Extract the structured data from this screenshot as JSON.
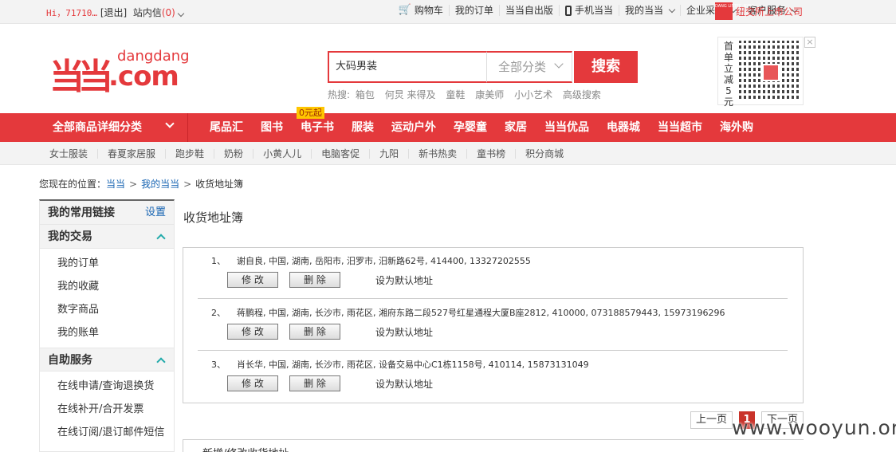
{
  "topbar": {
    "greeting": "Hi，71710…",
    "logout": "[退出]",
    "messages": "站内信",
    "message_count": "(0)",
    "links": [
      "购物车",
      "我的订单",
      "当当自出版",
      "手机当当",
      "我的当当",
      "企业采购",
      "客户服务"
    ],
    "nyse_badge": "DANG LISTED NYSE",
    "nyse_text": "纽交所上市公司"
  },
  "logo": {
    "cn": "当当",
    "en": "dangdang",
    "com": ".com"
  },
  "search": {
    "value": "大码男装",
    "category": "全部分类",
    "button": "搜索",
    "hot_label": "热搜:",
    "hot_words": [
      "箱包",
      "何炅 来得及",
      "童鞋",
      "康美师",
      "小小艺术",
      "高级搜索"
    ]
  },
  "qr": {
    "text": "首单立减5元",
    "close": "×"
  },
  "nav": {
    "all_categories": "全部商品详细分类",
    "items": [
      "尾品汇",
      "图书",
      "电子书",
      "服装",
      "运动户外",
      "孕婴童",
      "家居",
      "当当优品",
      "电器城",
      "当当超市",
      "海外购"
    ],
    "badge": "0元起"
  },
  "subnav": [
    "女士服装",
    "春夏家居服",
    "跑步鞋",
    "奶粉",
    "小黄人儿",
    "电脑客促",
    "九阳",
    "新书热卖",
    "童书榜",
    "积分商城"
  ],
  "breadcrumb": {
    "prefix": "您现在的位置：",
    "items": [
      "当当",
      "我的当当"
    ],
    "current": "收货地址簿"
  },
  "sidebar": {
    "links_title": "我的常用链接",
    "links_action": "设置",
    "trade_title": "我的交易",
    "trade_items": [
      "我的订单",
      "我的收藏",
      "数字商品",
      "我的账单"
    ],
    "service_title": "自助服务",
    "service_items": [
      "在线申请/查询退换货",
      "在线补开/合开发票",
      "在线订阅/退订邮件短信"
    ]
  },
  "main": {
    "title": "收货地址簿",
    "addresses": [
      {
        "no": "1、",
        "text": "谢自良, 中国, 湖南, 岳阳市, 汨罗市, 汨新路62号, 414400, 13327202555"
      },
      {
        "no": "2、",
        "text": "蒋鹏程, 中国, 湖南, 长沙市, 雨花区, 湘府东路二段527号红星通程大厦B座2812, 410000, 073188579443, 15973196296"
      },
      {
        "no": "3、",
        "text": "肖长华, 中国, 湖南, 长沙市, 雨花区, 设备交易中心C1栋1158号, 410114, 15873131049"
      }
    ],
    "modify": "修 改",
    "delete": "删 除",
    "set_default": "设为默认地址",
    "pager": {
      "prev": "上一页",
      "current": "1",
      "next": "下一页"
    },
    "new_title": "新增/修改收货地址"
  },
  "watermark": "www.wooyun.org",
  "colors": {
    "brand": "#e4393c",
    "link": "#1a66b3"
  }
}
